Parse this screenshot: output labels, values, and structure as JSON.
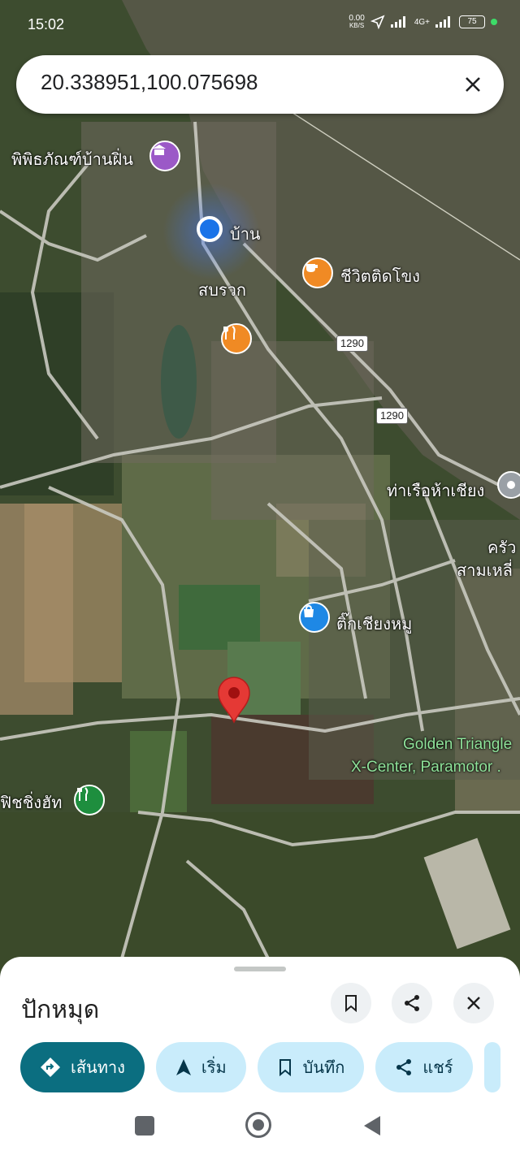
{
  "status_bar": {
    "time": "15:02",
    "data_speed": "0.00",
    "data_unit": "KB/S",
    "network": "4G+",
    "battery": "75"
  },
  "search": {
    "value": "20.338951,100.075698"
  },
  "map": {
    "labels": {
      "museum": "พิพิธภัณฑ์บ้านฝิ่น",
      "home": "บ้าน",
      "sop_ruak": "สบรวก",
      "cafe": "ชีวิตติดโขง",
      "pier": "ท่าเรือห้าเชียง",
      "kitchen_1": "ครัว",
      "kitchen_2": "สามเหลี่",
      "shop": "ติ๊กเชียงหมู",
      "golden_1": "Golden Triangle",
      "golden_2": "X-Center, Paramotor .",
      "fishing": "ฟิชชิ่งฮัท"
    },
    "route_shields": [
      "1290",
      "1290"
    ],
    "icons": [
      "museum-icon",
      "location-dot-icon",
      "cafe-icon",
      "restaurant-icon",
      "shopping-icon",
      "park-icon",
      "dropped-pin-icon"
    ]
  },
  "sheet": {
    "title": "ปักหมุด",
    "chips": {
      "directions": "เส้นทาง",
      "start": "เริ่ม",
      "save": "บันทึก",
      "share": "แชร์"
    }
  },
  "colors": {
    "primary": "#0b6e80",
    "chip": "#c9ecfb",
    "pin": "#e53935"
  }
}
